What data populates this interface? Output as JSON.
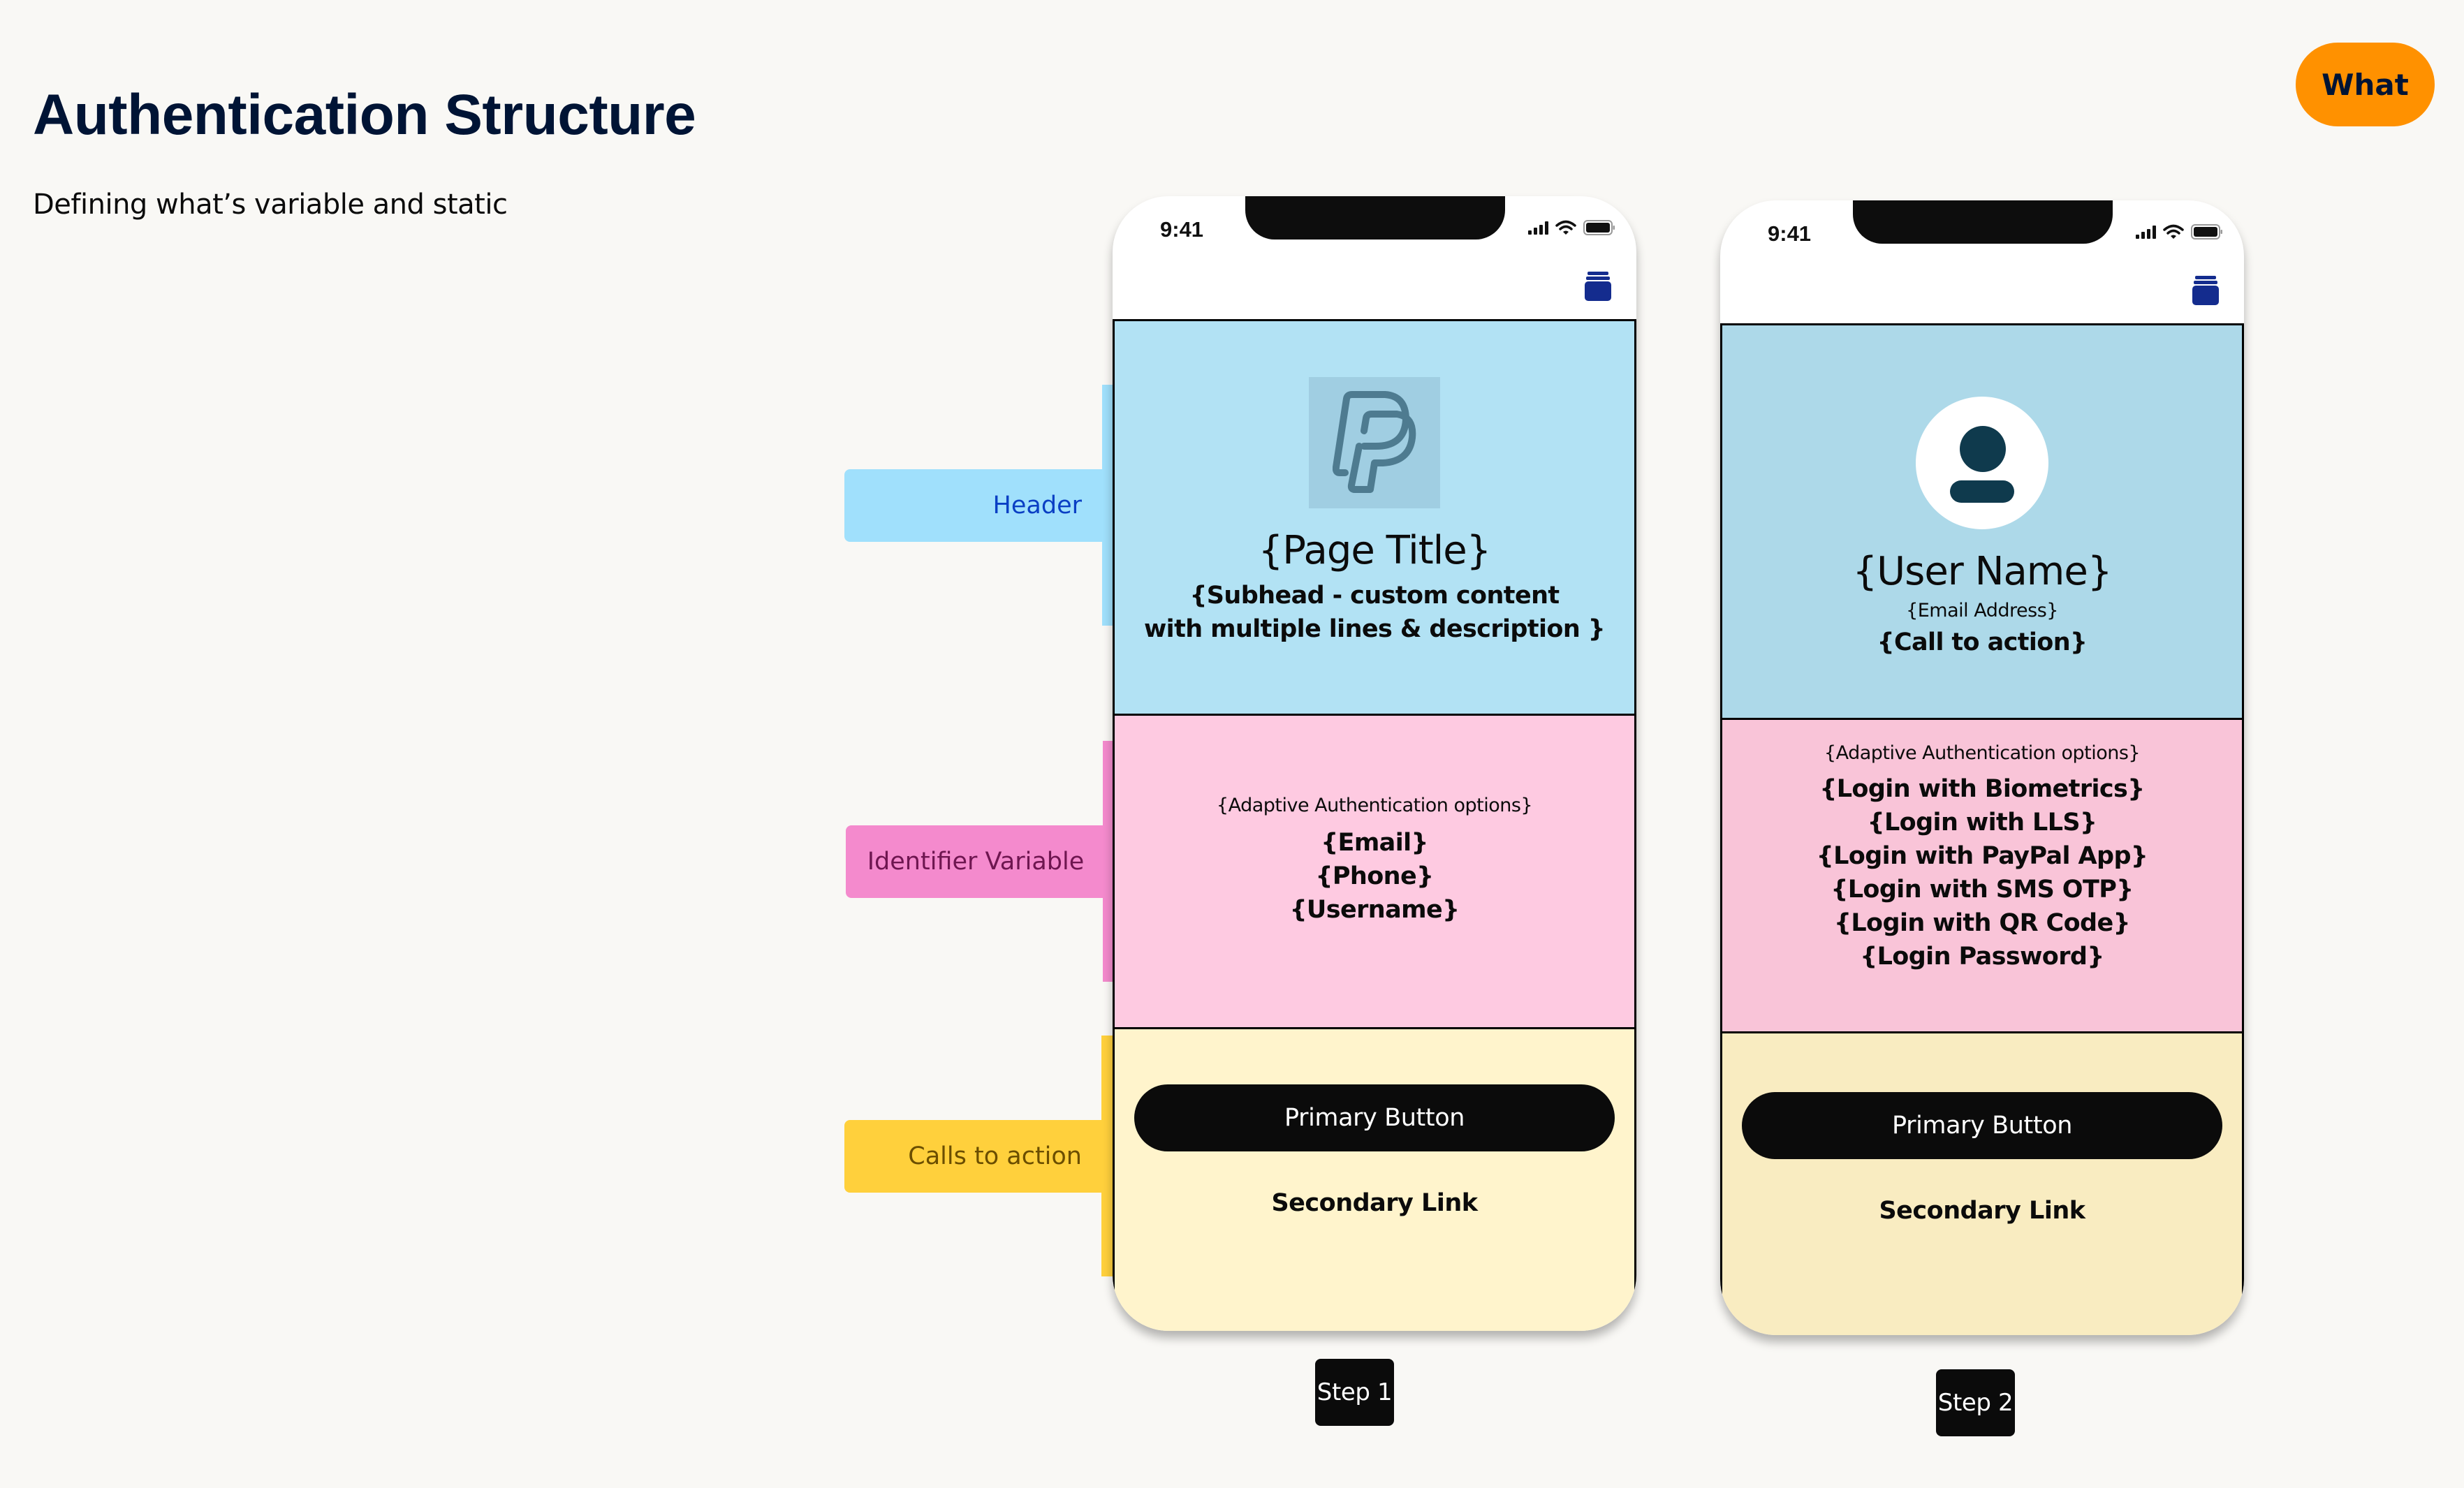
{
  "page": {
    "title": "Authentication Structure",
    "subtitle": "Defining what’s variable and static",
    "badge": "What"
  },
  "colors": {
    "background": "#F9F8F5",
    "title": "#001435",
    "badge_bg": "#FF9100",
    "header_label_bg": "#A0E0FC",
    "header_label_text": "#0A3FC4",
    "identifier_label_bg": "#F48ACD",
    "identifier_label_text": "#6E1650",
    "cta_label_bg": "#FFD03C",
    "cta_label_text": "#6B4E00",
    "header_section": "#B2E2F4",
    "header_section_step2": "#ADD9E9",
    "identifier_section": "#FECAE1",
    "identifier_section_step2": "#F9C4D8",
    "cta_section": "#FFF4CC",
    "cta_section_step2": "#F9ECC1",
    "wallet_icon": "#142C8E"
  },
  "annotations": [
    {
      "label": "Header",
      "section": "header"
    },
    {
      "label": "Identifier Variable",
      "section": "identifier"
    },
    {
      "label": "Calls to action",
      "section": "cta"
    }
  ],
  "phones": [
    {
      "status_time": "9:41",
      "header": {
        "icon": "paypal-logo-icon",
        "title": "{Page Title}",
        "subhead_lines": [
          "{Subhead - custom content",
          "with multiple lines & description }"
        ]
      },
      "identifier": {
        "note": "{Adaptive Authentication options}",
        "options": [
          "{Email}",
          "{Phone}",
          "{Username}"
        ]
      },
      "cta": {
        "primary": "Primary Button",
        "secondary": "Secondary Link"
      },
      "step": "Step 1"
    },
    {
      "status_time": "9:41",
      "header": {
        "icon": "user-avatar-icon",
        "title": "{User Name}",
        "email": "{Email Address}",
        "call_to_action": "{Call to action}"
      },
      "identifier": {
        "note": "{Adaptive Authentication options}",
        "options": [
          "{Login with Biometrics}",
          "{Login with LLS}",
          "{Login with PayPal App}",
          "{Login with SMS OTP}",
          "{Login with QR Code}",
          "{Login Password}"
        ]
      },
      "cta": {
        "primary": "Primary Button",
        "secondary": "Secondary Link"
      },
      "step": "Step 2"
    }
  ]
}
